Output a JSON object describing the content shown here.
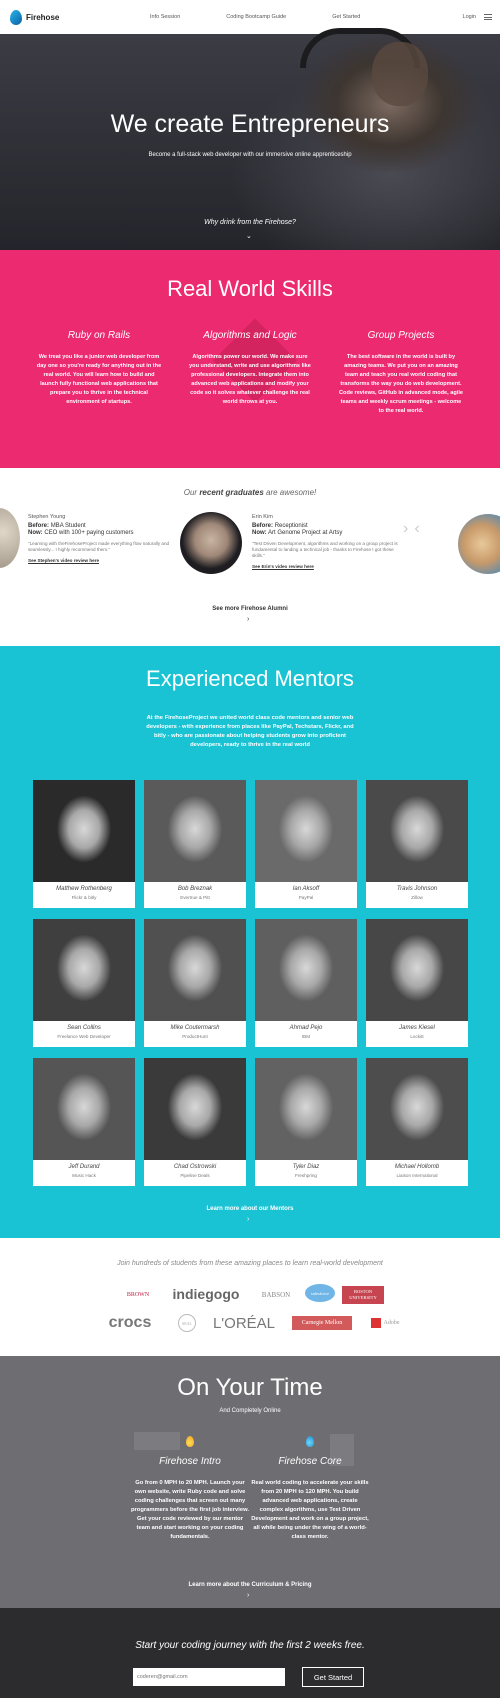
{
  "nav": {
    "brand": "Firehose",
    "links": [
      "Info Session",
      "Coding Bootcamp Guide",
      "Get Started"
    ],
    "login": "Login"
  },
  "hero": {
    "title": "We create Entrepreneurs",
    "subtitle": "Become a full-stack web developer with our immersive online apprenticeship",
    "cta": "Why drink from the Firehose?"
  },
  "skills": {
    "title": "Real World Skills",
    "items": [
      {
        "title": "Ruby on Rails",
        "text": "We treat you like a junior web developer from day one so you're ready for anything out in the real world. You will learn how to build and launch fully functional web applications that prepare you to thrive in the technical environment of startups."
      },
      {
        "title": "Algorithms and Logic",
        "text": "Algorithms power our world. We make sure you understand, write and use algorithms like professional developers. Integrate them into advanced web applications and modify your code so it solves whatever challenge the real world throws at you."
      },
      {
        "title": "Group Projects",
        "text": "The best software in the world is built by amazing teams. We put you on an amazing team and teach you real world coding that transforms the way you do web development. Code reviews, GitHub in advanced mode, agile teams and weekly scrum meetings - welcome to the real world."
      }
    ]
  },
  "graduates": {
    "title_prefix": "Our",
    "title_bold": "recent graduates",
    "title_suffix": "are awesome!",
    "items": [
      {
        "name": "Stephen Young",
        "before_label": "Before:",
        "before": "MBA Student",
        "now_label": "Now:",
        "now": "CEO with 100+ paying customers",
        "quote": "\"Learning with theFirehoseProject made everything flow naturally and seamlessly... I highly recommend them.\"",
        "link": "See Stephen's video review here"
      },
      {
        "name": "Erin Kim",
        "before_label": "Before:",
        "before": "Receptionist",
        "now_label": "Now:",
        "now": "Art Genome Project at Artsy",
        "quote": "\"Test Driven Development, algorithms and working on a group project is fundamental to landing a technical job - thanks to Firehose I got these skills.\"",
        "link": "See Erin's video review here"
      }
    ],
    "more": "See more Firehose Alumni"
  },
  "mentors": {
    "title": "Experienced Mentors",
    "description": "At the FirehoseProject we united world class code mentors and senior web developers - with experience from places like PayPal, Techstars, Flickr, and bitly - who are passionate about helping students grow into proficient developers, ready to thrive in the real world",
    "items": [
      {
        "name": "Matthew Rothenberg",
        "company": "Flickr & bitly"
      },
      {
        "name": "Bob Breznak",
        "company": "Evertrue & Pitt"
      },
      {
        "name": "Ian Aksoff",
        "company": "PayPal"
      },
      {
        "name": "Travis Johnson",
        "company": "Zillow"
      },
      {
        "name": "Sean Collins",
        "company": "Freelance Web Developer"
      },
      {
        "name": "Mike Coutermarsh",
        "company": "ProductHunt"
      },
      {
        "name": "Ahmad Pejo",
        "company": "IBM"
      },
      {
        "name": "James Kiesel",
        "company": "Lockitt"
      },
      {
        "name": "Jeff Durand",
        "company": "Music Hack"
      },
      {
        "name": "Chad Ostrowski",
        "company": "Pipeline Deals"
      },
      {
        "name": "Tyler Diaz",
        "company": "Freshpring"
      },
      {
        "name": "Michael Hollomb",
        "company": "Liaison International"
      }
    ],
    "more": "Learn more about our Mentors"
  },
  "partners": {
    "title": "Join hundreds of students from these amazing places to learn real-world development",
    "logos": [
      "BROWN",
      "indiegogo",
      "BABSON",
      "salesforce",
      "BOSTON UNIVERSITY",
      "crocs",
      "SEAL",
      "L'ORÉAL",
      "Carnegie Mellon",
      "Adobe"
    ]
  },
  "time": {
    "title": "On Your Time",
    "subtitle": "And Completely Online",
    "items": [
      {
        "title": "Firehose Intro",
        "text": "Go from 0 MPH to 20 MPH. Launch your own website, write Ruby code and solve coding challenges that screen out many programmers before the first job interview. Get your code reviewed by our mentor team and start working on your coding fundamentals."
      },
      {
        "title": "Firehose Core",
        "text": "Real world coding to accelerate your skills from 20 MPH to 120 MPH. You build advanced web applications, create complex algorithms, use Test Driven Development and work on a group project, all while being under the wing of a world-class mentor."
      }
    ],
    "more": "Learn more about the Curriculum & Pricing"
  },
  "cta": {
    "title": "Start your coding journey with the first 2 weeks free.",
    "placeholder": "coderen@gmail.com",
    "button": "Get Started"
  },
  "colors": {
    "pink": "#ec2a6f",
    "teal": "#1ac3d3",
    "gray": "#6e6d72",
    "dark": "#2c2c2e"
  },
  "icons": [
    "firehose-logo-icon",
    "menu-icon",
    "chevron-down-icon",
    "chevron-left-icon",
    "chevron-right-icon",
    "flame-orange-icon",
    "flame-blue-icon"
  ]
}
